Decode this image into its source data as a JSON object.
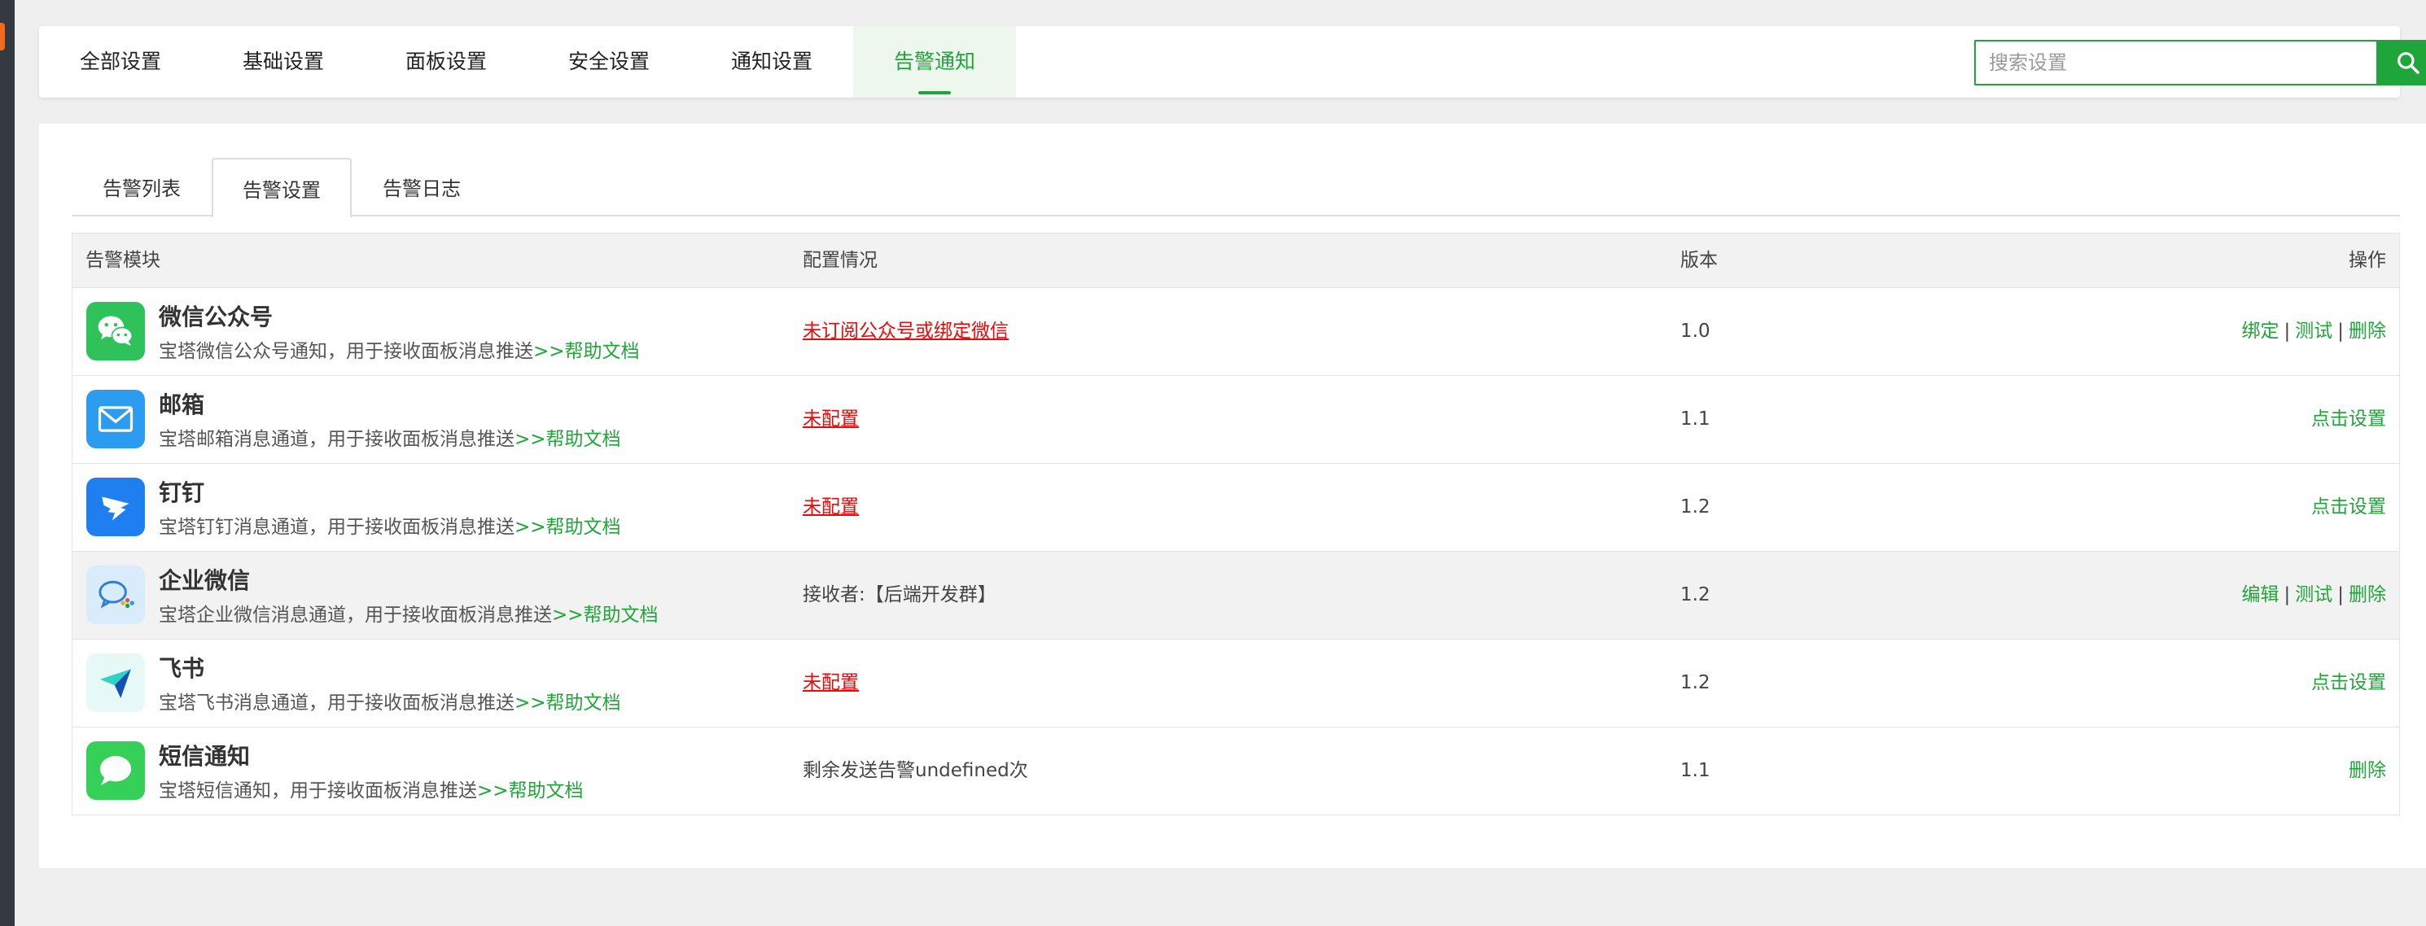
{
  "nav": {
    "tabs": [
      {
        "label": "全部设置"
      },
      {
        "label": "基础设置"
      },
      {
        "label": "面板设置"
      },
      {
        "label": "安全设置"
      },
      {
        "label": "通知设置"
      },
      {
        "label": "告警通知"
      }
    ],
    "active_tab": "告警通知",
    "search_placeholder": "搜索设置"
  },
  "subtabs": {
    "items": [
      {
        "label": "告警列表"
      },
      {
        "label": "告警设置"
      },
      {
        "label": "告警日志"
      }
    ],
    "active": "告警设置"
  },
  "table": {
    "headers": {
      "module": "告警模块",
      "config": "配置情况",
      "version": "版本",
      "actions": "操作"
    },
    "help_text": ">>帮助文档",
    "rows": [
      {
        "name": "微信公众号",
        "desc": "宝塔微信公众号通知，用于接收面板消息推送",
        "config": "未订阅公众号或绑定微信",
        "version": "1.0",
        "icon": "wechat-icon",
        "ops": [
          "绑定",
          "测试",
          "删除"
        ]
      },
      {
        "name": "邮箱",
        "desc": "宝塔邮箱消息通道，用于接收面板消息推送",
        "config": "未配置",
        "version": "1.1",
        "icon": "mail-icon",
        "ops": [
          "点击设置"
        ]
      },
      {
        "name": "钉钉",
        "desc": "宝塔钉钉消息通道，用于接收面板消息推送",
        "config": "未配置",
        "version": "1.2",
        "icon": "dingtalk-icon",
        "ops": [
          "点击设置"
        ]
      },
      {
        "name": "企业微信",
        "desc": "宝塔企业微信消息通道，用于接收面板消息推送",
        "config": "接收者:【后端开发群】",
        "version": "1.2",
        "icon": "wecom-icon",
        "ops": [
          "编辑",
          "测试",
          "删除"
        ]
      },
      {
        "name": "飞书",
        "desc": "宝塔飞书消息通道，用于接收面板消息推送",
        "config": "未配置",
        "version": "1.2",
        "icon": "feishu-icon",
        "ops": [
          "点击设置"
        ]
      },
      {
        "name": "短信通知",
        "desc": "宝塔短信通知，用于接收面板消息推送",
        "config": "剩余发送告警undefined次",
        "version": "1.1",
        "icon": "sms-icon",
        "ops": [
          "删除"
        ]
      }
    ]
  },
  "colors": {
    "accent": "#20a53a",
    "warning": "#ef0808"
  }
}
